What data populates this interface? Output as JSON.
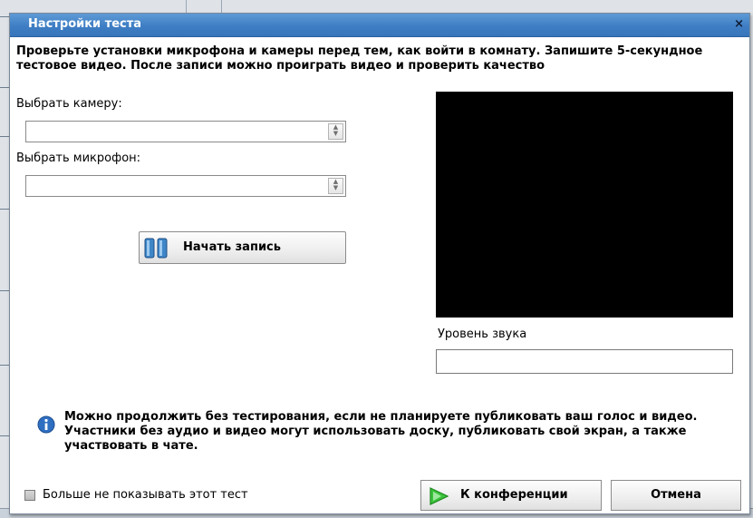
{
  "dialog": {
    "title": "Настройки теста",
    "close_label": "×",
    "intro": "Проверьте установки микрофона и камеры перед тем, как войти в комнату. Запишите 5-секундное тестовое видео. После записи можно проиграть видео и проверить качество"
  },
  "camera": {
    "label": "Выбрать камеру:",
    "value": ""
  },
  "microphone": {
    "label": "Выбрать микрофон:",
    "value": ""
  },
  "record_button": {
    "label": "Начать запись",
    "icon": "pause-icon"
  },
  "sound_level": {
    "label": "Уровень звука"
  },
  "info": {
    "icon": "info-icon",
    "text": "Можно продолжить без тестирования, если не планируете публиковать ваш голос и видео. Участники без аудио и видео могут использовать доску, публиковать свой экран, а также участвовать в чате."
  },
  "footer": {
    "dont_show_label": "Больше не показывать этот тест",
    "dont_show_checked": false,
    "join_button": "К конференции",
    "join_icon": "play-arrow-icon",
    "cancel_button": "Отмена"
  },
  "colors": {
    "titlebar": "#3f7ec4",
    "accent_green": "#2bb22b",
    "video_bg": "#000000"
  }
}
